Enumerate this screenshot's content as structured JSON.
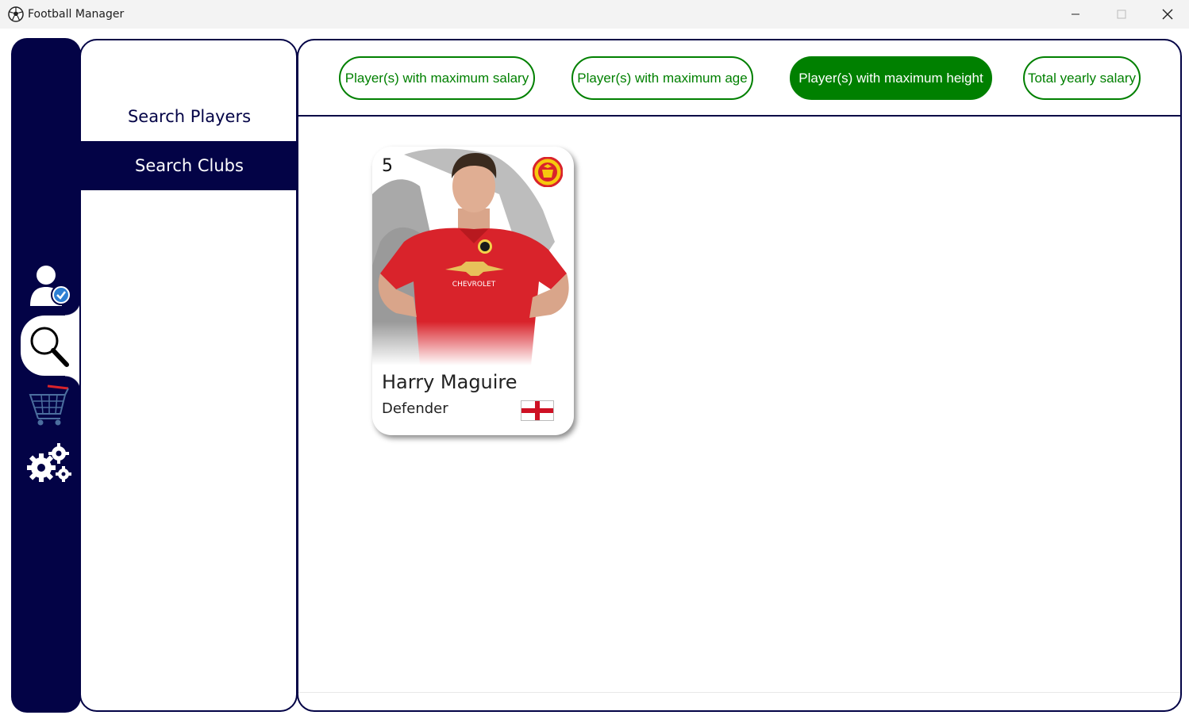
{
  "window": {
    "title": "Football Manager",
    "icon": "soccer-ball-icon",
    "controls": [
      "minimize-icon",
      "maximize-icon",
      "close-icon"
    ]
  },
  "rail": {
    "items": [
      {
        "icon": "user-verified-icon",
        "selected": false
      },
      {
        "icon": "search-icon",
        "selected": true
      },
      {
        "icon": "shopping-cart-icon",
        "selected": false
      },
      {
        "icon": "settings-gears-icon",
        "selected": false
      }
    ]
  },
  "menu": {
    "items": [
      {
        "label": "Search Players",
        "selected": false
      },
      {
        "label": "Search Clubs",
        "selected": true
      }
    ]
  },
  "filters": [
    {
      "label": "Player(s) with maximum salary",
      "active": false
    },
    {
      "label": "Player(s) with maximum age",
      "active": false
    },
    {
      "label": "Player(s) with maximum height",
      "active": true
    },
    {
      "label": "Total yearly salary",
      "active": false
    }
  ],
  "card": {
    "number": "5",
    "name": "Harry Maguire",
    "position": "Defender",
    "club_logo": "manchester-united-crest-icon",
    "flag": "england-flag-icon"
  },
  "colors": {
    "navy": "#030346",
    "green": "#008000",
    "kit_red": "#d9232b"
  }
}
